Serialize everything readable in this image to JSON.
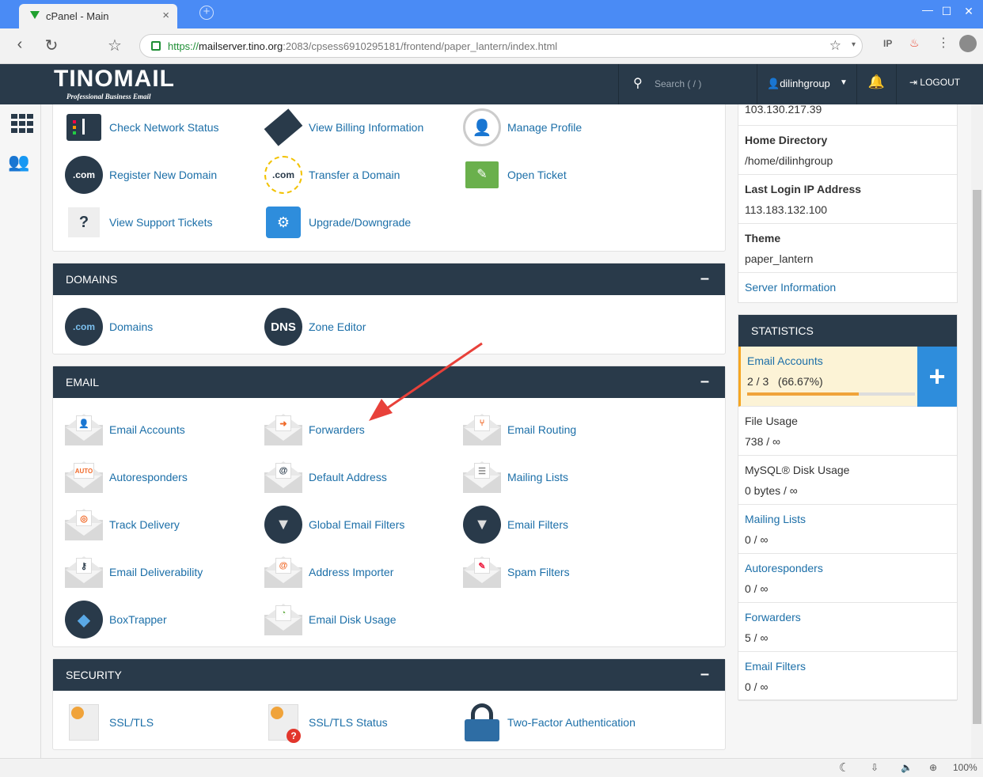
{
  "browser": {
    "tab_title": "cPanel - Main",
    "url_scheme": "https://",
    "url_host": "mailserver.tino.org",
    "url_rest": ":2083/cpsess6910295181/frontend/paper_lantern/index.html",
    "zoom": "100%"
  },
  "topbar": {
    "logo": "TINOMAIL",
    "logo_tagline": "Professional Business Email",
    "search_placeholder": "Search ( / )",
    "username": "dilinhgroup",
    "logout": "LOGOUT"
  },
  "general": {
    "items": [
      {
        "label": "Check Network Status"
      },
      {
        "label": "View Billing Information"
      },
      {
        "label": "Manage Profile"
      },
      {
        "label": "Register New Domain",
        "badge": ".com"
      },
      {
        "label": "Transfer a Domain",
        "badge": ".com"
      },
      {
        "label": "Open Ticket"
      },
      {
        "label": "View Support Tickets"
      },
      {
        "label": "Upgrade/Downgrade"
      }
    ]
  },
  "domains": {
    "title": "DOMAINS",
    "items": [
      {
        "label": "Domains",
        "badge": ".com"
      },
      {
        "label": "Zone Editor",
        "badge": "DNS"
      }
    ]
  },
  "email": {
    "title": "EMAIL",
    "items": [
      {
        "label": "Email Accounts"
      },
      {
        "label": "Forwarders"
      },
      {
        "label": "Email Routing"
      },
      {
        "label": "Autoresponders",
        "badge": "AUTO"
      },
      {
        "label": "Default Address",
        "badge": "@"
      },
      {
        "label": "Mailing Lists"
      },
      {
        "label": "Track Delivery"
      },
      {
        "label": "Global Email Filters"
      },
      {
        "label": "Email Filters"
      },
      {
        "label": "Email Deliverability"
      },
      {
        "label": "Address Importer",
        "badge": "@"
      },
      {
        "label": "Spam Filters"
      },
      {
        "label": "BoxTrapper"
      },
      {
        "label": "Email Disk Usage"
      }
    ]
  },
  "security": {
    "title": "SECURITY",
    "items": [
      {
        "label": "SSL/TLS"
      },
      {
        "label": "SSL/TLS Status"
      },
      {
        "label": "Two-Factor Authentication"
      }
    ]
  },
  "general_info": {
    "shared_ip": "103.130.217.39",
    "rows": [
      {
        "key": "Home Directory",
        "value": "/home/dilinhgroup"
      },
      {
        "key": "Last Login IP Address",
        "value": "113.183.132.100"
      },
      {
        "key": "Theme",
        "value": "paper_lantern"
      }
    ],
    "server_info_link": "Server Information"
  },
  "statistics": {
    "title": "STATISTICS",
    "email_accounts": {
      "label": "Email Accounts",
      "value": "2 / 3   (66.67%)",
      "percent": 66.67
    },
    "rows": [
      {
        "key": "File Usage",
        "value": "738 / ∞",
        "link": false
      },
      {
        "key": "MySQL® Disk Usage",
        "value": "0 bytes / ∞",
        "link": false
      },
      {
        "key": "Mailing Lists",
        "value": "0 / ∞",
        "link": true
      },
      {
        "key": "Autoresponders",
        "value": "0 / ∞",
        "link": true
      },
      {
        "key": "Forwarders",
        "value": "5 / ∞",
        "link": true
      },
      {
        "key": "Email Filters",
        "value": "0 / ∞",
        "link": true
      }
    ]
  },
  "colors": {
    "nav": "#293a4a",
    "link": "#1c6fa8",
    "accent": "#2e8ddc",
    "annotation": "#e8413a"
  }
}
